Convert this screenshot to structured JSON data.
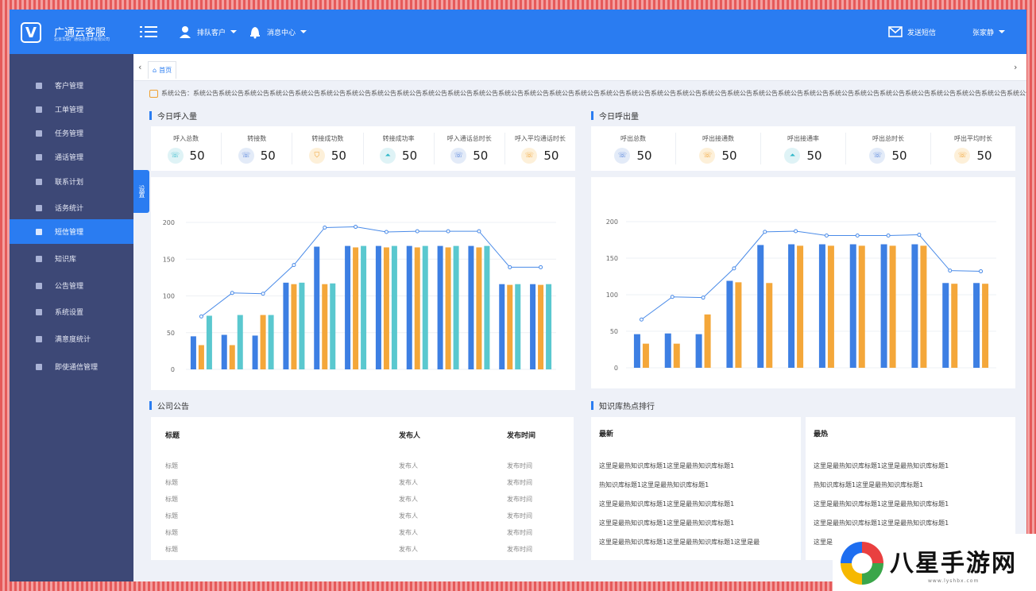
{
  "header": {
    "brand_title": "广通云客服",
    "brand_subtitle": "北京华联广通信息技术有限公司",
    "queue_label": "排队客户",
    "message_label": "消息中心",
    "sms_label": "发送短信",
    "user_name": "张家静"
  },
  "sidebar": {
    "items": [
      {
        "label": "客户管理"
      },
      {
        "label": "工单管理"
      },
      {
        "label": "任务管理"
      },
      {
        "label": "通话管理"
      },
      {
        "label": "联系计划"
      },
      {
        "label": "话务统计"
      },
      {
        "label": "短信管理"
      },
      {
        "label": "知识库"
      },
      {
        "label": "公告管理"
      },
      {
        "label": "系统设置"
      },
      {
        "label": "满意度统计"
      },
      {
        "label": "即使通信管理"
      }
    ],
    "active_index": 6,
    "settings_tab": "设置"
  },
  "tabs": {
    "home": "首页"
  },
  "notice": "系统公告：系统公告系统公告系统公告系统公告系统公告系统公告系统公告系统公告系统公告系统公告系统公告系统公告系统公告系统公告系统公告系统公告系统公告系统公告系统公告系统公告系统公告系统公告系统公告系统公告系统公告系统公告系统公告系统公告系统公告系统公告系统公告系统公告系统公告系统公告系统公告系统公告系统公告系统公告系统公告系统公告系统公告系统公告系统公告",
  "inbound": {
    "title": "今日呼入量",
    "stats": [
      {
        "label": "呼入总数",
        "value": "50",
        "icon": "phone-icon",
        "color": "#dff3f6",
        "fg": "#2fb8c9"
      },
      {
        "label": "转接数",
        "value": "50",
        "icon": "transfer-icon",
        "color": "#e3ebf8",
        "fg": "#4a7bd8"
      },
      {
        "label": "转接成功数",
        "value": "50",
        "icon": "shield-icon",
        "color": "#fdf0d9",
        "fg": "#f0a030"
      },
      {
        "label": "转接成功率",
        "value": "50",
        "icon": "chart-icon",
        "color": "#dff3f6",
        "fg": "#2fb8c9"
      },
      {
        "label": "呼入通话总时长",
        "value": "50",
        "icon": "phone-icon",
        "color": "#e3ebf8",
        "fg": "#4a7bd8"
      },
      {
        "label": "呼入平均通话时长",
        "value": "50",
        "icon": "phone-icon",
        "color": "#fdf0d9",
        "fg": "#f0a030"
      }
    ]
  },
  "outbound": {
    "title": "今日呼出量",
    "stats": [
      {
        "label": "呼出总数",
        "value": "50",
        "icon": "phone-icon",
        "color": "#e3ebf8",
        "fg": "#4a7bd8"
      },
      {
        "label": "呼出接通数",
        "value": "50",
        "icon": "phone-icon",
        "color": "#fdf0d9",
        "fg": "#f0a030"
      },
      {
        "label": "呼出接通率",
        "value": "50",
        "icon": "chart-icon",
        "color": "#dff3f6",
        "fg": "#2fb8c9"
      },
      {
        "label": "呼出总时长",
        "value": "50",
        "icon": "phone-icon",
        "color": "#e3ebf8",
        "fg": "#4a7bd8"
      },
      {
        "label": "呼出平均时长",
        "value": "50",
        "icon": "phone-icon",
        "color": "#fdf0d9",
        "fg": "#f0a030"
      }
    ]
  },
  "chart_data": [
    {
      "type": "bar",
      "ylim": [
        0,
        200
      ],
      "yticks": [
        0,
        50,
        100,
        150,
        200
      ],
      "colors": [
        "#3d7fe3",
        "#f4a73a",
        "#5ac8cf"
      ],
      "line_color": "#4a8be8",
      "series": [
        {
          "values": [
            45,
            47,
            46,
            118,
            167,
            168,
            168,
            168,
            168,
            168,
            116,
            116
          ]
        },
        {
          "values": [
            33,
            33,
            74,
            116,
            116,
            166,
            166,
            166,
            166,
            166,
            115,
            115
          ]
        },
        {
          "values": [
            73,
            74,
            74,
            118,
            117,
            168,
            168,
            168,
            168,
            168,
            116,
            116
          ]
        }
      ],
      "line": [
        72,
        104,
        103,
        142,
        193,
        194,
        187,
        188,
        188,
        188,
        139,
        139
      ]
    },
    {
      "type": "bar",
      "ylim": [
        0,
        200
      ],
      "yticks": [
        0,
        50,
        100,
        150,
        200
      ],
      "colors": [
        "#3d7fe3",
        "#f4a73a"
      ],
      "line_color": "#4a8be8",
      "series": [
        {
          "values": [
            46,
            47,
            46,
            119,
            168,
            169,
            169,
            169,
            169,
            169,
            116,
            116
          ]
        },
        {
          "values": [
            33,
            33,
            73,
            117,
            116,
            167,
            167,
            167,
            167,
            167,
            115,
            115
          ]
        }
      ],
      "line": [
        66,
        97,
        96,
        136,
        186,
        187,
        181,
        181,
        181,
        182,
        133,
        132
      ]
    }
  ],
  "announcements": {
    "title": "公司公告",
    "headers": [
      "标题",
      "发布人",
      "发布时间"
    ],
    "rows": [
      [
        "标题",
        "发布人",
        "发布时间"
      ],
      [
        "标题",
        "发布人",
        "发布时间"
      ],
      [
        "标题",
        "发布人",
        "发布时间"
      ],
      [
        "标题",
        "发布人",
        "发布时间"
      ],
      [
        "标题",
        "发布人",
        "发布时间"
      ],
      [
        "标题",
        "发布人",
        "发布时间"
      ]
    ]
  },
  "knowledge": {
    "title": "知识库热点排行",
    "latest": {
      "header": "最新",
      "items": [
        "这里是最热知识库标题1这里是最热知识库标题1",
        "热知识库标题1这里是最热知识库标题1",
        "这里是最热知识库标题1这里是最热知识库标题1",
        "这里是最热知识库标题1这里是最热知识库标题1",
        "这里是最热知识库标题1这里是最热知识库标题1这里是最"
      ]
    },
    "hottest": {
      "header": "最热",
      "items": [
        "这里是最热知识库标题1这里是最热知识库标题1",
        "热知识库标题1这里是最热知识库标题1",
        "这里是最热知识库标题1这里是最热知识库标题1",
        "这里是最热知识库标题1这里是最热知识库标题1",
        "这里是最热知识库标题1这里是最热知识库标题1这里是最"
      ]
    }
  },
  "watermark": {
    "text": "八星手游网",
    "url": "www.lyshbx.com"
  }
}
